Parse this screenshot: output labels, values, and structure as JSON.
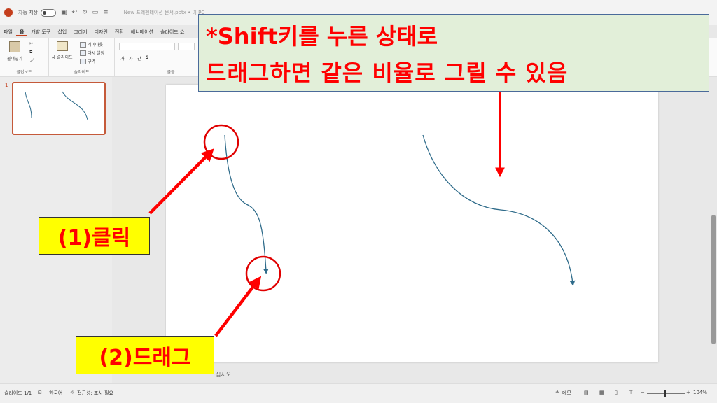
{
  "titlebar": {
    "autosave_label": "자동 저장",
    "doc_title": "New 프레젠테이션 문서.pptx • 이 PC"
  },
  "menu": {
    "tabs": [
      "파일",
      "홈",
      "개발 도구",
      "삽입",
      "그리기",
      "디자인",
      "전환",
      "애니메이션",
      "슬라이드 쇼"
    ]
  },
  "ribbon": {
    "paste_label": "붙여넣기",
    "clipboard_group": "클립보드",
    "new_slide_label": "새 슬라이드",
    "layout_label": "레이아웃",
    "reset_label": "다시 설정",
    "section_label": "구역",
    "slides_group": "슬라이드",
    "font_group": "글꼴"
  },
  "slides": {
    "current_number": "1"
  },
  "notes": {
    "placeholder_partial": "십시오"
  },
  "statusbar": {
    "slide_count": "슬라이드 1/1",
    "language": "한국어",
    "accessibility": "접근성: 조사 필요",
    "notes_label": "메모",
    "zoom": "104%"
  },
  "overlay": {
    "top_line1": "*Shift키를 누른 상태로",
    "top_line2": "드래그하면 같은 비율로 그릴 수 있음",
    "step1": "(1)클릭",
    "step2": "(2)드래그"
  },
  "colors": {
    "annotation_red": "#ff0000",
    "label_yellow": "#ffff00",
    "callout_green": "#e2efd9",
    "curve_blue": "#2e6b8a",
    "accent": "#c43e1c"
  }
}
